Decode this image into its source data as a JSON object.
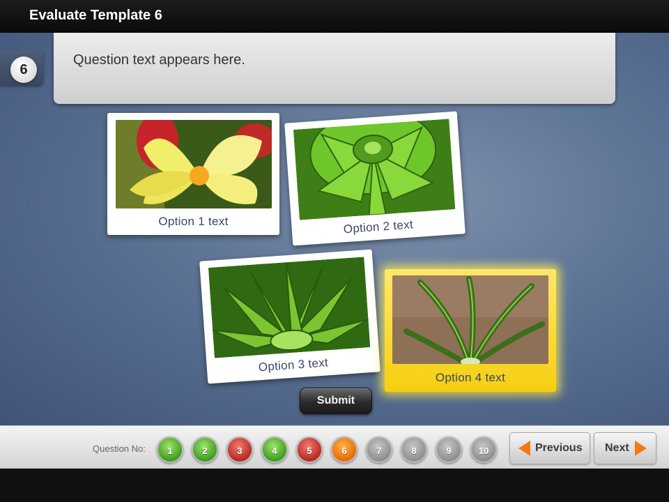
{
  "header": {
    "title": "Evaluate Template 6"
  },
  "question": {
    "number": "6",
    "text": "Question text appears here."
  },
  "options": [
    {
      "label": "Option 1 text",
      "selected": false
    },
    {
      "label": "Option 2 text",
      "selected": false
    },
    {
      "label": "Option 3 text",
      "selected": false
    },
    {
      "label": "Option 4 text",
      "selected": true
    }
  ],
  "submit_label": "Submit",
  "footer": {
    "question_no_label": "Question No:",
    "questions": [
      {
        "label": "1",
        "status": "correct"
      },
      {
        "label": "2",
        "status": "correct"
      },
      {
        "label": "3",
        "status": "incorrect"
      },
      {
        "label": "4",
        "status": "correct"
      },
      {
        "label": "5",
        "status": "incorrect"
      },
      {
        "label": "6",
        "status": "current"
      },
      {
        "label": "7",
        "status": "unanswered"
      },
      {
        "label": "8",
        "status": "unanswered"
      },
      {
        "label": "9",
        "status": "unanswered"
      },
      {
        "label": "10",
        "status": "unanswered"
      }
    ],
    "previous_label": "Previous",
    "next_label": "Next"
  },
  "colors": {
    "correct": "#3f9d1d",
    "incorrect": "#b9281f",
    "current": "#e66d00",
    "unanswered": "#8f8f8f",
    "selected_card": "#f5cf10",
    "nav_arrow": "#f07a17"
  },
  "icons": {
    "previous": "left-arrow-icon",
    "next": "right-arrow-icon"
  }
}
